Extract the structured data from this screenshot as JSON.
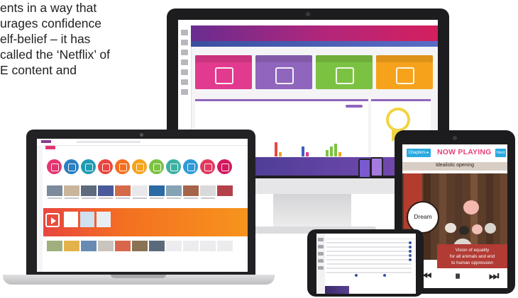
{
  "intro_text": {
    "lines": [
      "ents in a way that",
      "urages confidence",
      "elf-belief – it has",
      "called the ‘Netflix’ of",
      "E content and"
    ]
  },
  "tablet": {
    "chapters_button": "Chapters ▸",
    "now_playing": "NOW PLAYING",
    "next_button": "Next",
    "track_title": "Idealistic opening",
    "dream_label": "Dream",
    "quote_lines": [
      "Vision of equality",
      "for all animals and end",
      "to human oppression"
    ],
    "controls": {
      "prev": "⏮",
      "pause": "⏸",
      "next": "⏭"
    },
    "colors": {
      "accent": "#29a9e0",
      "title": "#e8407a",
      "quote_bg": "#b23b34"
    }
  },
  "monitor": {
    "header_title": "",
    "subheader": "",
    "tile_colors": [
      "#e13a8e",
      "#8f65bd",
      "#7cc242",
      "#f6a31b"
    ]
  },
  "laptop": {
    "circle_colors": [
      "#e2366f",
      "#2c7fc1",
      "#1f9bb4",
      "#e9463f",
      "#f37021",
      "#f6a31b",
      "#7cc242",
      "#3cb0a3",
      "#2f9ad6",
      "#e13a5f",
      "#d4185e"
    ]
  }
}
